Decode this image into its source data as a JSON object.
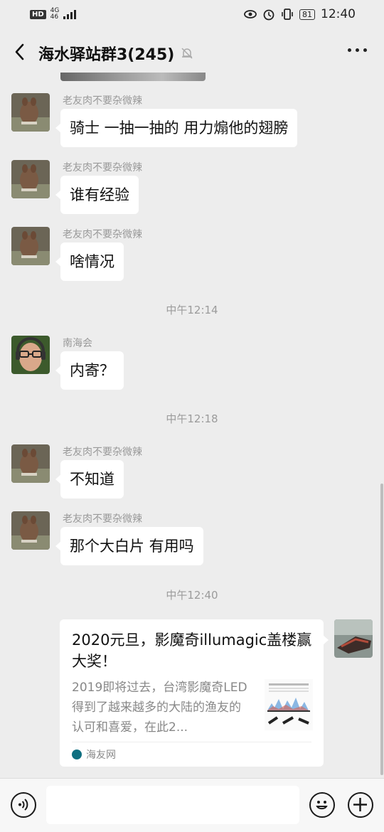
{
  "status_bar": {
    "hd": "HD",
    "net_top": "4G",
    "net_bottom": "46",
    "battery": "81",
    "time": "12:40"
  },
  "header": {
    "title": "海水驿站群3(245)",
    "back_icon": "chevron-left-icon",
    "mute_icon": "bell-off-icon",
    "more_icon": "more-dots-icon"
  },
  "messages": [
    {
      "sender": "老友肉不要杂微辣",
      "text": "骑士 一抽一抽的 用力煽他的翅膀"
    },
    {
      "sender": "老友肉不要杂微辣",
      "text": "谁有经验"
    },
    {
      "sender": "老友肉不要杂微辣",
      "text": "啥情况"
    },
    {
      "sender": "南海会",
      "text": "内寄？"
    },
    {
      "sender": "老友肉不要杂微辣",
      "text": "不知道"
    },
    {
      "sender": "老友肉不要杂微辣",
      "text": "那个大白片  有用吗"
    }
  ],
  "timestamps": [
    "中午12:14",
    "中午12:18",
    "中午12:40"
  ],
  "link_card": {
    "title": "2020元旦，影魔奇illumagic盖楼赢大奖！",
    "description": "2019即将过去，台湾影魔奇LED得到了越来越多的大陆的渔友的认可和喜爱，在此2...",
    "source": "海友网"
  },
  "input_bar": {
    "placeholder": "",
    "voice_icon": "voice-icon",
    "emoji_icon": "emoji-icon",
    "plus_icon": "plus-icon"
  }
}
